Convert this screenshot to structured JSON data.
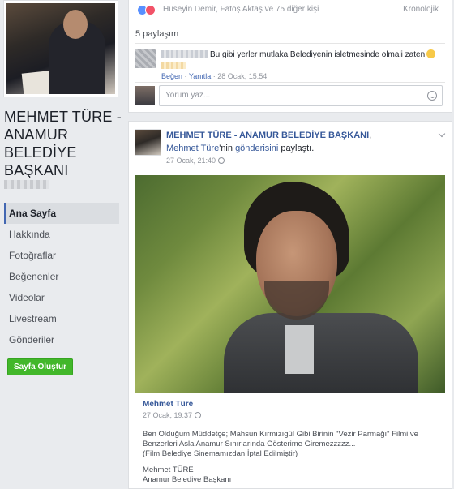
{
  "sidebar": {
    "page_name": "MEHMET TÜRE - ANAMUR BELEDİYE BAŞKANI",
    "nav": [
      {
        "label": "Ana Sayfa"
      },
      {
        "label": "Hakkında"
      },
      {
        "label": "Fotoğraflar"
      },
      {
        "label": "Beğenenler"
      },
      {
        "label": "Videolar"
      },
      {
        "label": "Livestream"
      },
      {
        "label": "Gönderiler"
      }
    ],
    "create_page_label": "Sayfa Oluştur"
  },
  "top_post": {
    "reactors_text": "Hüseyin Demir, Fatoş Aktaş ve 75 diğer kişi",
    "chronology_label": "Kronolojik",
    "shares_text": "5 paylaşım",
    "comment": {
      "text": "Bu gibi yerler mutlaka Belediyenin isletmesinde olmali zaten",
      "like_label": "Beğen",
      "reply_label": "Yanıtla",
      "time": "28 Ocak, 15:54"
    },
    "comment_placeholder": "Yorum yaz..."
  },
  "shared_post": {
    "page_name": "MEHMET TÜRE - ANAMUR BELEDİYE BAŞKANI",
    "comma": ",",
    "author": "Mehmet Türe",
    "possessive": "'nin ",
    "post_link": "gönderisini",
    "action_rest": " paylaştı.",
    "time": "27 Ocak, 21:40",
    "original": {
      "author": "Mehmet Türe",
      "time": "27 Ocak, 19:37",
      "text_line1": "Ben Olduğum Müddetçe; Mahsun Kırmızıgül Gibi Birinin \"Vezir Parmağı\" Filmi ve",
      "text_line2": "Benzerleri Asla Anamur Sınırlarında Gösterime Giremezzzzz...",
      "text_line3": "(Film Belediye Sinemamızdan İptal Edilmiştir)",
      "sign_line1": "Mehmet TÜRE",
      "sign_line2": "Anamur Belediye Başkanı"
    }
  },
  "colors": {
    "link": "#365899",
    "accent": "#4267b2",
    "create_button": "#42b72a",
    "background": "#e9ebee"
  }
}
